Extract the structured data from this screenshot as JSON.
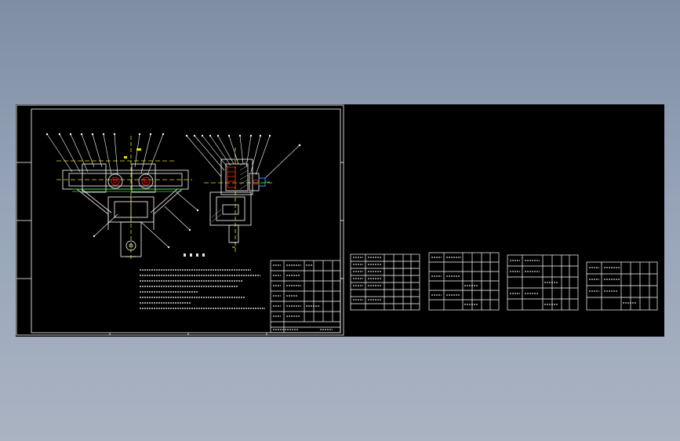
{
  "window": {
    "background_top": "#7f8ea5",
    "background_bottom": "#aab3c2"
  },
  "drawing": {
    "sheet_stroke": "#ffffff",
    "accent_red": "#ff2020",
    "accent_yellow": "#e8e000",
    "accent_green": "#39d24a",
    "accent_cyan": "#3fc8ff"
  }
}
